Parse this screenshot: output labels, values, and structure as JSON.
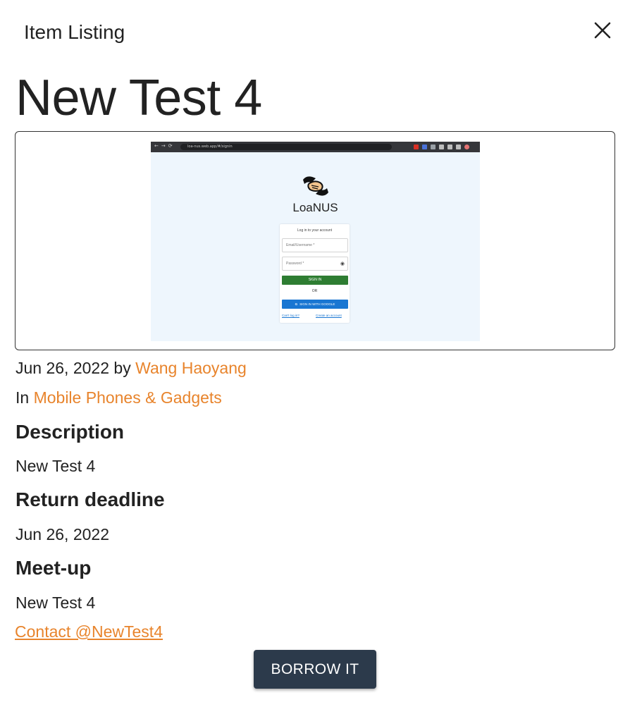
{
  "dialog": {
    "title": "Item Listing",
    "close_icon": "close-icon"
  },
  "item": {
    "title": "New Test 4",
    "date": "Jun 26, 2022",
    "by_word": "by",
    "owner": "Wang Haoyang",
    "in_word": "In",
    "category": "Mobile Phones & Gadgets",
    "description_heading": "Description",
    "description": "New Test 4",
    "deadline_heading": "Return deadline",
    "deadline": "Jun 26, 2022",
    "meetup_heading": "Meet-up",
    "meetup": "New Test 4",
    "contact_link": "Contact @NewTest4"
  },
  "image_preview": {
    "browser_url": "loa-nus.web.app/#/signin",
    "brand": "LoaNUS",
    "login_title": "Log in to your account",
    "email_placeholder": "Email/Username *",
    "password_placeholder": "Password *",
    "sign_in_label": "SIGN IN",
    "or_label": "OR",
    "google_label": "SIGN IN WITH GOOGLE",
    "cant_login": "Can't log in?",
    "create_account": "Create an account"
  },
  "actions": {
    "borrow_label": "BORROW IT"
  },
  "colors": {
    "accent_orange": "#e8842c",
    "button_dark": "#2c3a4b",
    "text": "#222222"
  }
}
